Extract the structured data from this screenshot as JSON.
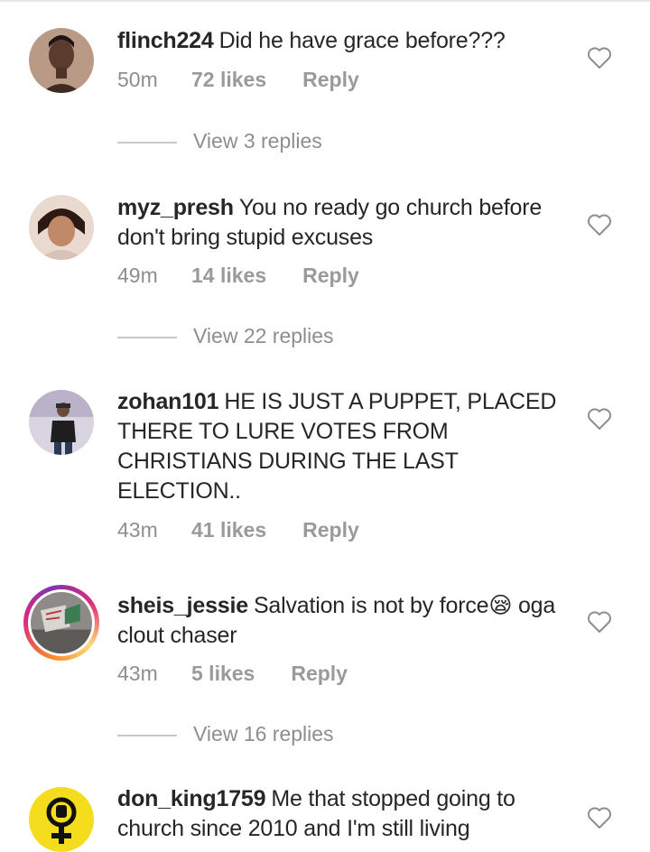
{
  "comments": [
    {
      "username": "flinch224",
      "text": "Did he have grace before???",
      "time": "50m",
      "likes": "72 likes",
      "reply_label": "Reply",
      "view_replies": "View 3 replies"
    },
    {
      "username": "myz_presh",
      "text": "You no ready go church before don't bring stupid excuses",
      "time": "49m",
      "likes": "14 likes",
      "reply_label": "Reply",
      "view_replies": "View 22 replies"
    },
    {
      "username": "zohan101",
      "text": "HE IS JUST A PUPPET, PLACED THERE TO LURE VOTES FROM CHRISTIANS DURING THE LAST ELECTION..",
      "time": "43m",
      "likes": "41 likes",
      "reply_label": "Reply"
    },
    {
      "username": "sheis_jessie",
      "text": "Salvation is not by force😪 oga clout chaser",
      "time": "43m",
      "likes": "5 likes",
      "reply_label": "Reply",
      "view_replies": "View 16 replies"
    },
    {
      "username": "don_king1759",
      "text": "Me that stopped going to church since 2010 and I'm still living"
    }
  ],
  "icons": {
    "like": "heart-outline-icon",
    "avatar_badge": "female-symbol-fist-icon"
  },
  "colors": {
    "text": "#262626",
    "secondary": "#8e8e8e",
    "story_ring": "#dd2a7b",
    "avatar_yellow": "#f5dc1c"
  }
}
